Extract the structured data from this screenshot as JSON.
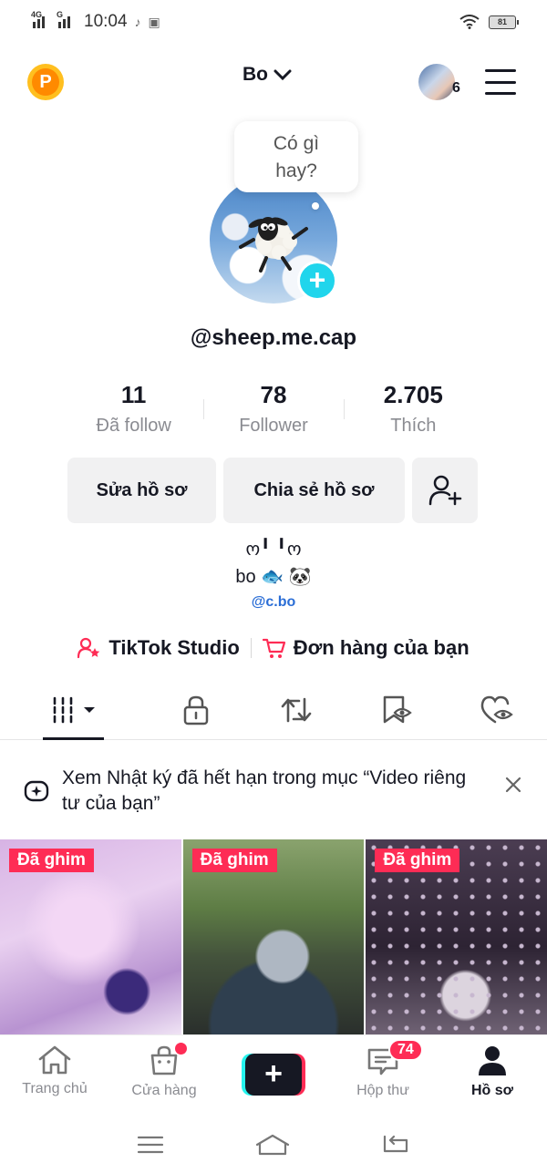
{
  "status_bar": {
    "network1": "4G",
    "network2": "G",
    "time": "10:04",
    "battery": "81"
  },
  "header": {
    "coin_label": "P",
    "account_name": "Bo",
    "friends_count": "6"
  },
  "profile": {
    "bubble_text": "Có gì hay?",
    "username": "@sheep.me.cap",
    "stats": [
      {
        "value": "11",
        "label": "Đã follow"
      },
      {
        "value": "78",
        "label": "Follower"
      },
      {
        "value": "2.705",
        "label": "Thích"
      }
    ],
    "edit_button": "Sửa hồ sơ",
    "share_button": "Chia sẻ hồ sơ",
    "bio_line1": "ო╹  ╹ო",
    "bio_line2": "bo 🐟 🐼",
    "bio_tag": "@c.bo"
  },
  "links": {
    "studio": "TikTok Studio",
    "orders": "Đơn hàng của bạn"
  },
  "tabs": [
    {
      "name": "videos",
      "icon": "grid-icon"
    },
    {
      "name": "private",
      "icon": "lock-icon"
    },
    {
      "name": "reposts",
      "icon": "repost-icon"
    },
    {
      "name": "favorites",
      "icon": "bookmark-icon"
    },
    {
      "name": "liked",
      "icon": "heart-icon"
    }
  ],
  "notice": {
    "text": "Xem Nhật ký đã hết hạn trong mục “Video riêng tư của bạn”"
  },
  "videos": [
    {
      "badge": "Đã ghim"
    },
    {
      "badge": "Đã ghim"
    },
    {
      "badge": "Đã ghim"
    }
  ],
  "bottom_nav": {
    "home": "Trang chủ",
    "shop": "Cửa hàng",
    "create": "+",
    "inbox": "Hộp thư",
    "inbox_count": "74",
    "profile": "Hồ sơ"
  },
  "colors": {
    "accent": "#fe2c55",
    "cyan": "#25f4ee",
    "link_blue": "#2b6ed6",
    "text": "#161823",
    "muted": "#8a8b91"
  }
}
